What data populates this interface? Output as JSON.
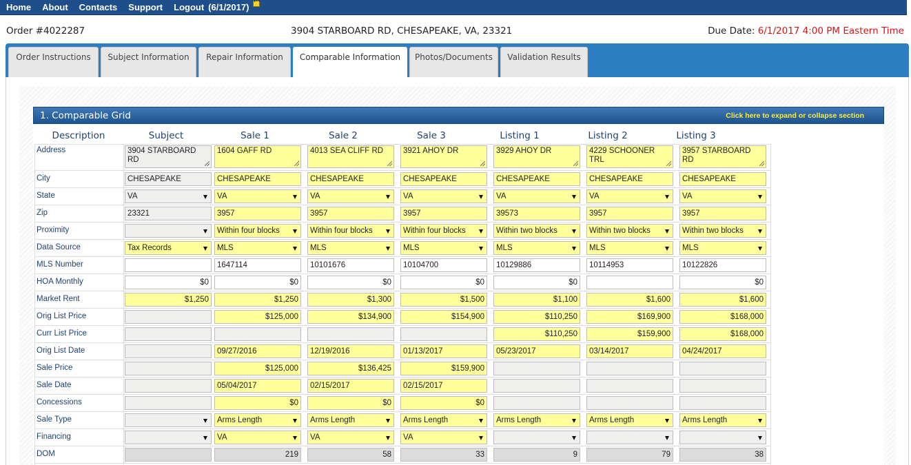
{
  "nav": {
    "items": [
      "Home",
      "About",
      "Contacts",
      "Support",
      "Logout"
    ],
    "date": "(6/1/2017)"
  },
  "order": {
    "number": "Order #4022287",
    "address": "3904 STARBOARD RD, CHESAPEAKE, VA, 23321",
    "due_label": "Due Date:",
    "due_value": "6/1/2017 4:00 PM Eastern Time"
  },
  "tabs": [
    "Order Instructions",
    "Subject Information",
    "Repair Information",
    "Comparable Information",
    "Photos/Documents",
    "Validation Results"
  ],
  "active_tab": "Comparable Information",
  "section": {
    "title": "1. Comparable Grid",
    "toggle": "Click here to expand or collapse section"
  },
  "grid": {
    "headers": [
      "Description",
      "Subject",
      "Sale 1",
      "Sale 2",
      "Sale 3",
      "Listing 1",
      "Listing 2",
      "Listing 3"
    ],
    "rows": [
      {
        "label": "Address",
        "kind": "area",
        "cells": [
          {
            "v": "3904 STARBOARD RD",
            "c": "gray"
          },
          {
            "v": "1604 GAFF RD",
            "c": "yellow"
          },
          {
            "v": "4013 SEA CLIFF RD",
            "c": "yellow"
          },
          {
            "v": "3921 AHOY DR",
            "c": "yellow"
          },
          {
            "v": "3929 AHOY DR",
            "c": "yellow"
          },
          {
            "v": "4229 SCHOONER TRL",
            "c": "yellow"
          },
          {
            "v": "3957 STARBOARD RD",
            "c": "yellow"
          }
        ]
      },
      {
        "label": "City",
        "kind": "text",
        "cells": [
          {
            "v": "CHESAPEAKE",
            "c": "gray"
          },
          {
            "v": "CHESAPEAKE",
            "c": "yellow"
          },
          {
            "v": "CHESAPEAKE",
            "c": "yellow"
          },
          {
            "v": "CHESAPEAKE",
            "c": "yellow"
          },
          {
            "v": "CHESAPEAKE",
            "c": "yellow"
          },
          {
            "v": "CHESAPEAKE",
            "c": "yellow"
          },
          {
            "v": "CHESAPEAKE",
            "c": "yellow"
          }
        ]
      },
      {
        "label": "State",
        "kind": "select",
        "cells": [
          {
            "v": "VA",
            "c": "gray"
          },
          {
            "v": "VA",
            "c": "yellow"
          },
          {
            "v": "VA",
            "c": "yellow"
          },
          {
            "v": "VA",
            "c": "yellow"
          },
          {
            "v": "VA",
            "c": "yellow"
          },
          {
            "v": "VA",
            "c": "yellow"
          },
          {
            "v": "VA",
            "c": "yellow"
          }
        ]
      },
      {
        "label": "Zip",
        "kind": "text",
        "cells": [
          {
            "v": "23321",
            "c": "gray"
          },
          {
            "v": "3957",
            "c": "yellow"
          },
          {
            "v": "3957",
            "c": "yellow"
          },
          {
            "v": "3957",
            "c": "yellow"
          },
          {
            "v": "39573",
            "c": "yellow"
          },
          {
            "v": "3957",
            "c": "yellow"
          },
          {
            "v": "3957",
            "c": "yellow"
          }
        ]
      },
      {
        "label": "Proximity",
        "kind": "select",
        "cells": [
          {
            "v": "",
            "c": "gray"
          },
          {
            "v": "Within four blocks",
            "c": "yellow"
          },
          {
            "v": "Within four blocks",
            "c": "yellow"
          },
          {
            "v": "Within four blocks",
            "c": "yellow"
          },
          {
            "v": "Within two blocks",
            "c": "yellow"
          },
          {
            "v": "Within two blocks",
            "c": "yellow"
          },
          {
            "v": "Within two blocks",
            "c": "yellow"
          }
        ]
      },
      {
        "label": "Data Source",
        "kind": "select",
        "cells": [
          {
            "v": "Tax Records",
            "c": "yellow"
          },
          {
            "v": "MLS",
            "c": "yellow"
          },
          {
            "v": "MLS",
            "c": "yellow"
          },
          {
            "v": "MLS",
            "c": "yellow"
          },
          {
            "v": "MLS",
            "c": "yellow"
          },
          {
            "v": "MLS",
            "c": "yellow"
          },
          {
            "v": "MLS",
            "c": "yellow"
          }
        ]
      },
      {
        "label": "MLS Number",
        "kind": "text",
        "cells": [
          {
            "v": "",
            "c": "white"
          },
          {
            "v": "1647114",
            "c": "white"
          },
          {
            "v": "10101676",
            "c": "white"
          },
          {
            "v": "10104700",
            "c": "white"
          },
          {
            "v": "10129886",
            "c": "white"
          },
          {
            "v": "10114953",
            "c": "white"
          },
          {
            "v": "10122826",
            "c": "white"
          }
        ]
      },
      {
        "label": "HOA Monthly",
        "kind": "num",
        "cells": [
          {
            "v": "$0",
            "c": "white"
          },
          {
            "v": "$0",
            "c": "white"
          },
          {
            "v": "$0",
            "c": "white"
          },
          {
            "v": "$0",
            "c": "white"
          },
          {
            "v": "$0",
            "c": "white"
          },
          {
            "v": "",
            "c": "white"
          },
          {
            "v": "$0",
            "c": "white"
          }
        ]
      },
      {
        "label": "Market Rent",
        "kind": "num",
        "cells": [
          {
            "v": "$1,250",
            "c": "yellow"
          },
          {
            "v": "$1,250",
            "c": "yellow"
          },
          {
            "v": "$1,300",
            "c": "yellow"
          },
          {
            "v": "$1,500",
            "c": "yellow"
          },
          {
            "v": "$1,100",
            "c": "yellow"
          },
          {
            "v": "$1,600",
            "c": "yellow"
          },
          {
            "v": "$1,600",
            "c": "yellow"
          }
        ]
      },
      {
        "label": "Orig List Price",
        "kind": "num",
        "cells": [
          {
            "v": "",
            "c": "gray"
          },
          {
            "v": "$125,000",
            "c": "yellow"
          },
          {
            "v": "$134,900",
            "c": "yellow"
          },
          {
            "v": "$154,900",
            "c": "yellow"
          },
          {
            "v": "$110,250",
            "c": "yellow"
          },
          {
            "v": "$169,900",
            "c": "yellow"
          },
          {
            "v": "$168,000",
            "c": "yellow"
          }
        ]
      },
      {
        "label": "Curr List Price",
        "kind": "num",
        "cells": [
          {
            "v": "",
            "c": "gray"
          },
          {
            "v": "",
            "c": "gray"
          },
          {
            "v": "",
            "c": "gray"
          },
          {
            "v": "",
            "c": "gray"
          },
          {
            "v": "$110,250",
            "c": "yellow"
          },
          {
            "v": "$159,900",
            "c": "yellow"
          },
          {
            "v": "$168,000",
            "c": "yellow"
          }
        ]
      },
      {
        "label": "Orig List Date",
        "kind": "text",
        "cells": [
          {
            "v": "",
            "c": "gray"
          },
          {
            "v": "09/27/2016",
            "c": "yellow"
          },
          {
            "v": "12/19/2016",
            "c": "yellow"
          },
          {
            "v": "01/13/2017",
            "c": "yellow"
          },
          {
            "v": "05/23/2017",
            "c": "yellow"
          },
          {
            "v": "03/14/2017",
            "c": "yellow"
          },
          {
            "v": "04/24/2017",
            "c": "yellow"
          }
        ]
      },
      {
        "label": "Sale Price",
        "kind": "num",
        "cells": [
          {
            "v": "",
            "c": "gray"
          },
          {
            "v": "$125,000",
            "c": "yellow"
          },
          {
            "v": "$136,425",
            "c": "yellow"
          },
          {
            "v": "$159,900",
            "c": "yellow"
          },
          {
            "v": "",
            "c": "gray"
          },
          {
            "v": "",
            "c": "gray"
          },
          {
            "v": "",
            "c": "gray"
          }
        ]
      },
      {
        "label": "Sale Date",
        "kind": "text",
        "cells": [
          {
            "v": "",
            "c": "gray"
          },
          {
            "v": "05/04/2017",
            "c": "yellow"
          },
          {
            "v": "02/15/2017",
            "c": "yellow"
          },
          {
            "v": "02/15/2017",
            "c": "yellow"
          },
          {
            "v": "",
            "c": "gray"
          },
          {
            "v": "",
            "c": "gray"
          },
          {
            "v": "",
            "c": "gray"
          }
        ]
      },
      {
        "label": "Concessions",
        "kind": "num",
        "cells": [
          {
            "v": "",
            "c": "gray"
          },
          {
            "v": "$0",
            "c": "yellow"
          },
          {
            "v": "$0",
            "c": "yellow"
          },
          {
            "v": "$0",
            "c": "yellow"
          },
          {
            "v": "",
            "c": "gray"
          },
          {
            "v": "",
            "c": "gray"
          },
          {
            "v": "",
            "c": "gray"
          }
        ]
      },
      {
        "label": "Sale Type",
        "kind": "select",
        "cells": [
          {
            "v": "",
            "c": "gray"
          },
          {
            "v": "Arms Length",
            "c": "yellow"
          },
          {
            "v": "Arms Length",
            "c": "yellow"
          },
          {
            "v": "Arms Length",
            "c": "yellow"
          },
          {
            "v": "Arms Length",
            "c": "yellow"
          },
          {
            "v": "Arms Length",
            "c": "yellow"
          },
          {
            "v": "Arms Length",
            "c": "yellow"
          }
        ]
      },
      {
        "label": "Financing",
        "kind": "select",
        "cells": [
          {
            "v": "",
            "c": "gray"
          },
          {
            "v": "VA",
            "c": "yellow"
          },
          {
            "v": "VA",
            "c": "yellow"
          },
          {
            "v": "VA",
            "c": "yellow"
          },
          {
            "v": "",
            "c": "gray"
          },
          {
            "v": "",
            "c": "gray"
          },
          {
            "v": "",
            "c": "gray"
          }
        ]
      },
      {
        "label": "DOM",
        "kind": "num",
        "cells": [
          {
            "v": "",
            "c": "dgray"
          },
          {
            "v": "219",
            "c": "dgray"
          },
          {
            "v": "58",
            "c": "dgray"
          },
          {
            "v": "33",
            "c": "dgray"
          },
          {
            "v": "9",
            "c": "dgray"
          },
          {
            "v": "79",
            "c": "dgray"
          },
          {
            "v": "38",
            "c": "dgray"
          }
        ]
      }
    ]
  }
}
